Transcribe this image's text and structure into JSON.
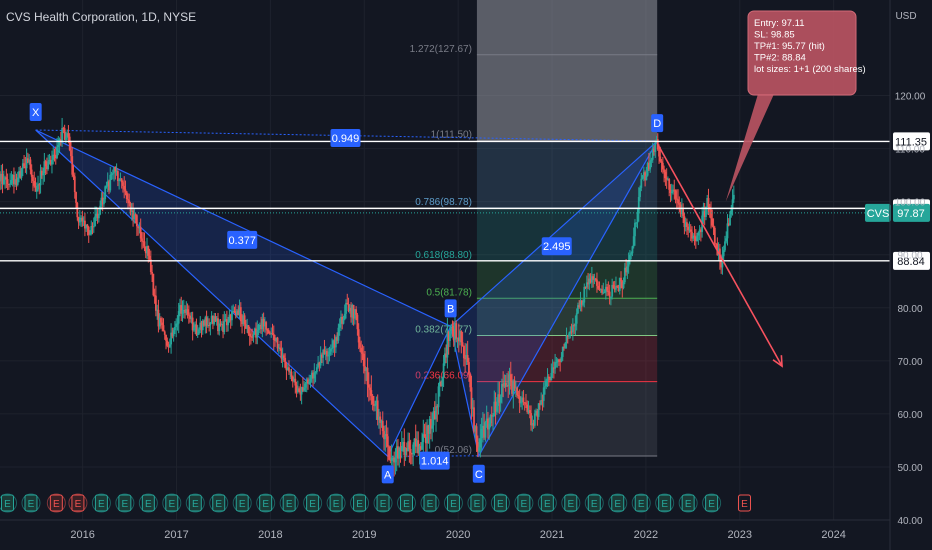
{
  "header": {
    "title": "CVS Health Corporation, 1D, NYSE"
  },
  "chart_data": {
    "type": "line",
    "title": "CVS Health Corporation, 1D, NYSE",
    "currency_label": "USD",
    "ylim": [
      40,
      138
    ],
    "y_ticks": [
      40,
      50,
      60,
      70,
      80,
      90,
      100,
      110,
      120
    ],
    "y_tick_labels": [
      "40.00",
      "50.00",
      "60.00",
      "70.00",
      "80.00",
      "90.00",
      "100.00",
      "110.00",
      "120.00"
    ],
    "x_ticks": [
      {
        "label": "2016",
        "x": 2016.0
      },
      {
        "label": "2017",
        "x": 2017.0
      },
      {
        "label": "2018",
        "x": 2018.0
      },
      {
        "label": "2019",
        "x": 2019.0
      },
      {
        "label": "2020",
        "x": 2020.0
      },
      {
        "label": "2021",
        "x": 2021.0
      },
      {
        "label": "2022",
        "x": 2022.0
      },
      {
        "label": "2023",
        "x": 2023.0
      },
      {
        "label": "2024",
        "x": 2024.0
      }
    ],
    "price_path": [
      [
        2015.12,
        104
      ],
      [
        2015.3,
        104
      ],
      [
        2015.42,
        108
      ],
      [
        2015.5,
        102
      ],
      [
        2015.6,
        107
      ],
      [
        2015.7,
        108
      ],
      [
        2015.78,
        113
      ],
      [
        2015.85,
        112
      ],
      [
        2015.95,
        97
      ],
      [
        2016.1,
        94
      ],
      [
        2016.2,
        100
      ],
      [
        2016.35,
        106
      ],
      [
        2016.45,
        101
      ],
      [
        2016.55,
        97
      ],
      [
        2016.7,
        90
      ],
      [
        2016.8,
        78
      ],
      [
        2016.9,
        73
      ],
      [
        2017.05,
        80
      ],
      [
        2017.2,
        76
      ],
      [
        2017.35,
        78
      ],
      [
        2017.5,
        76
      ],
      [
        2017.65,
        80
      ],
      [
        2017.8,
        74
      ],
      [
        2017.9,
        77
      ],
      [
        2018.0,
        76
      ],
      [
        2018.15,
        70
      ],
      [
        2018.3,
        64
      ],
      [
        2018.42,
        66
      ],
      [
        2018.55,
        71
      ],
      [
        2018.7,
        74
      ],
      [
        2018.8,
        80
      ],
      [
        2018.9,
        79
      ],
      [
        2019.0,
        68
      ],
      [
        2019.15,
        60
      ],
      [
        2019.25,
        53
      ],
      [
        2019.35,
        52.5
      ],
      [
        2019.5,
        54
      ],
      [
        2019.6,
        53
      ],
      [
        2019.75,
        60
      ],
      [
        2019.85,
        70
      ],
      [
        2019.9,
        75
      ],
      [
        2020.0,
        76
      ],
      [
        2020.1,
        70
      ],
      [
        2020.2,
        53
      ],
      [
        2020.3,
        58
      ],
      [
        2020.45,
        64
      ],
      [
        2020.55,
        66
      ],
      [
        2020.7,
        62
      ],
      [
        2020.8,
        58
      ],
      [
        2020.95,
        66
      ],
      [
        2021.1,
        71
      ],
      [
        2021.25,
        78
      ],
      [
        2021.4,
        86
      ],
      [
        2021.5,
        84
      ],
      [
        2021.6,
        83
      ],
      [
        2021.75,
        85
      ],
      [
        2021.85,
        92
      ],
      [
        2021.95,
        103
      ],
      [
        2022.05,
        108
      ],
      [
        2022.12,
        111
      ],
      [
        2022.22,
        104
      ],
      [
        2022.35,
        100
      ],
      [
        2022.45,
        94
      ],
      [
        2022.55,
        93
      ],
      [
        2022.65,
        100
      ],
      [
        2022.75,
        92
      ],
      [
        2022.8,
        88
      ],
      [
        2022.9,
        98
      ],
      [
        2022.95,
        102
      ]
    ],
    "volatile_window": [
      2019.0,
      2020.6
    ],
    "harmonic_points": [
      {
        "label": "X",
        "x": 2015.5,
        "y": 113.5
      },
      {
        "label": "A",
        "x": 2019.25,
        "y": 52.0
      },
      {
        "label": "B",
        "x": 2019.92,
        "y": 76.5
      },
      {
        "label": "C",
        "x": 2020.22,
        "y": 52.1
      },
      {
        "label": "D",
        "x": 2022.12,
        "y": 111.4
      }
    ],
    "harmonic_ratios": [
      {
        "label": "0.949",
        "x": 2018.8,
        "y": 112.0
      },
      {
        "label": "0.377",
        "x": 2017.7,
        "y": 92.8
      },
      {
        "label": "1.014",
        "x": 2019.75,
        "y": 51.2
      },
      {
        "label": "2.495",
        "x": 2021.05,
        "y": 91.6
      }
    ],
    "fib_levels": [
      {
        "label": "1.272(127.67)",
        "value": 127.67,
        "color": "#787b86"
      },
      {
        "label": "1(111.50)",
        "value": 111.5,
        "color": "#787b86"
      },
      {
        "label": "0.786(98.78)",
        "value": 98.78,
        "color": "#5d9cc9"
      },
      {
        "label": "0.618(88.80)",
        "value": 88.8,
        "color": "#26a69a"
      },
      {
        "label": "0.5(81.78)",
        "value": 81.78,
        "color": "#4caf50"
      },
      {
        "label": "0.382(74.77)",
        "value": 74.77,
        "color": "#81c784"
      },
      {
        "label": "0.236(66.09)",
        "value": 66.09,
        "color": "#f23645"
      },
      {
        "label": "0(52.06)",
        "value": 52.06,
        "color": "#787b86"
      }
    ],
    "fib_range_x": [
      2020.2,
      2022.12
    ],
    "horizontal_lines": [
      {
        "label": "111.35",
        "value": 111.35
      },
      {
        "label": "98.73",
        "value": 98.73
      },
      {
        "label": "88.84",
        "value": 88.84
      }
    ],
    "current_price": {
      "ticker": "CVS",
      "label": "97.87",
      "value": 97.87,
      "color": "#26a69a"
    },
    "trade_arrow": {
      "from": [
        2022.12,
        111.0
      ],
      "to": [
        2023.45,
        69.0
      ],
      "color": "#f7525f"
    },
    "callout": {
      "lines": [
        "Entry: 97.11",
        "SL: 98.85",
        "TP#1: 95.77 (hit)",
        "TP#2: 88.84",
        "lot sizes: 1+1 (200 shares)"
      ],
      "anchor": [
        2022.85,
        100.0
      ],
      "bg": "#b85462"
    },
    "earnings_markers": [
      {
        "x": 2015.2,
        "label": "E",
        "kind": "normal"
      },
      {
        "x": 2015.45,
        "label": "E",
        "kind": "normal"
      },
      {
        "x": 2015.72,
        "label": "E",
        "kind": "miss"
      },
      {
        "x": 2015.95,
        "label": "E",
        "kind": "miss"
      },
      {
        "x": 2016.2,
        "label": "E",
        "kind": "normal"
      },
      {
        "x": 2016.45,
        "label": "E",
        "kind": "normal"
      },
      {
        "x": 2016.7,
        "label": "E",
        "kind": "normal"
      },
      {
        "x": 2016.95,
        "label": "E",
        "kind": "normal"
      },
      {
        "x": 2017.2,
        "label": "E",
        "kind": "normal"
      },
      {
        "x": 2017.45,
        "label": "E",
        "kind": "normal"
      },
      {
        "x": 2017.7,
        "label": "E",
        "kind": "normal"
      },
      {
        "x": 2017.95,
        "label": "E",
        "kind": "normal"
      },
      {
        "x": 2018.2,
        "label": "E",
        "kind": "normal"
      },
      {
        "x": 2018.45,
        "label": "E",
        "kind": "normal"
      },
      {
        "x": 2018.7,
        "label": "E",
        "kind": "normal"
      },
      {
        "x": 2018.95,
        "label": "E",
        "kind": "normal"
      },
      {
        "x": 2019.2,
        "label": "E",
        "kind": "normal"
      },
      {
        "x": 2019.45,
        "label": "E",
        "kind": "normal"
      },
      {
        "x": 2019.7,
        "label": "E",
        "kind": "normal"
      },
      {
        "x": 2019.95,
        "label": "E",
        "kind": "normal"
      },
      {
        "x": 2020.2,
        "label": "E",
        "kind": "normal"
      },
      {
        "x": 2020.45,
        "label": "E",
        "kind": "normal"
      },
      {
        "x": 2020.7,
        "label": "E",
        "kind": "normal"
      },
      {
        "x": 2020.95,
        "label": "E",
        "kind": "normal"
      },
      {
        "x": 2021.2,
        "label": "E",
        "kind": "normal"
      },
      {
        "x": 2021.45,
        "label": "E",
        "kind": "normal"
      },
      {
        "x": 2021.7,
        "label": "E",
        "kind": "normal"
      },
      {
        "x": 2021.95,
        "label": "E",
        "kind": "normal"
      },
      {
        "x": 2022.2,
        "label": "E",
        "kind": "normal"
      },
      {
        "x": 2022.45,
        "label": "E",
        "kind": "normal"
      },
      {
        "x": 2022.7,
        "label": "E",
        "kind": "normal"
      },
      {
        "x": 2023.05,
        "label": "E",
        "kind": "future"
      }
    ],
    "colors": {
      "background": "#131722",
      "grid": "#1e222d",
      "up": "#26a69a",
      "down": "#ef5350",
      "pattern_fill": "#2962ff",
      "pattern_line": "#2962ff",
      "label_bg": "#2962ff",
      "axis_text": "#b2b5be"
    }
  }
}
